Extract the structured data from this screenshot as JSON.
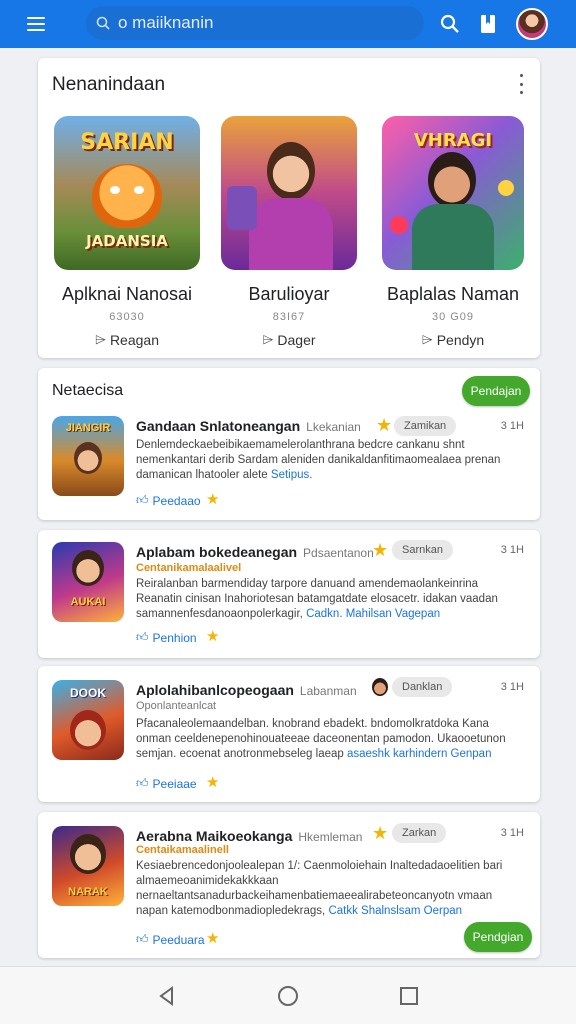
{
  "search": {
    "value": "o maiiknanin"
  },
  "featured": {
    "title": "Nenanindaan",
    "items": [
      {
        "name": "Aplknai Nanosai",
        "count": "63030",
        "tag": "Reagan",
        "art_text_top": "SARIAN",
        "art_text_bottom": "JADANSIA"
      },
      {
        "name": "Barulioyar",
        "count": "83I67",
        "tag": "Dager",
        "art_text_top": "",
        "art_text_bottom": ""
      },
      {
        "name": "Baplalas Naman",
        "count": "30 G09",
        "tag": "Pendyn",
        "art_text_top": "VHRAGI",
        "art_text_bottom": ""
      }
    ]
  },
  "list": {
    "title": "Netaecisa",
    "top_install_label": "Pendajan",
    "bottom_install_label": "Pendgian",
    "apps": [
      {
        "title": "Gandaan Snlatoneangan",
        "developer": "Lkekanian",
        "badge": "Zamikan",
        "time": "3 1H",
        "subtitle": "",
        "desc": "Denlemdeckaebeibikaemamelerolanthrana bedcre cankanu shnt nemenkantari derib Sardam aleniden danikaldanfitimaomealaea prenan damanican lhatooler alete",
        "desc_link": "Setipus.",
        "action": "Peedaao",
        "icon_text": "JIANGIR"
      },
      {
        "title": "Aplabam bokedeanegan",
        "developer": "Pdsaentanon",
        "badge": "Sarnkan",
        "time": "3 1H",
        "subtitle": "Centanikamalaalivel",
        "desc": "Reiralanban barmendiday tarpore danuand amendemaolankeinrina Reanatin cinisan Inahoriotesan batamgatdate elosacetr. idakan vaadan samannenfesdanoaonpolerkagir,",
        "desc_link": "Cadkn. Mahilsan Vagepan",
        "action": "Penhion",
        "icon_text": "AUKAI"
      },
      {
        "title": "Aplolahibanlcopeogaan",
        "developer": "Labanman",
        "badge": "Danklan",
        "time": "3 1H",
        "subtitle": "Oponlanteanlcat",
        "desc": "Pfacanaleolemaandelban. knobrand ebadekt. bndomolkratdoka Kana onman ceeldenepenohinouateeae daceonentan pamodon. Ukaooetunon semjan. ecoenat anotronmebseleg laeap",
        "desc_link": "asaeshk karhindern Genpan",
        "action": "Peeiaae",
        "icon_text": "DOOK"
      },
      {
        "title": "Aerabna Maikoeokanga",
        "developer": "Hkemleman",
        "badge": "Zarkan",
        "time": "3 1H",
        "subtitle": "Centaikamaalinell",
        "desc": "Kesiaebrencedonjoolealepan 1/: Caenmoloiehain Inaltedadaoelitien bari almaemeoanimidekakkkaan nernaeltantsanadurbackeihamenbatiemaeealirabeteoncanyotn vmaan napan katemodbonmadiopledekrags,",
        "desc_link": "Catkk Shalnslsam Oerpan",
        "action": "Peeduara",
        "icon_text": "NARAK"
      }
    ]
  },
  "colors": {
    "accent": "#1877e6",
    "green": "#43a82c",
    "star": "#f4b400",
    "link": "#1a73e8"
  }
}
